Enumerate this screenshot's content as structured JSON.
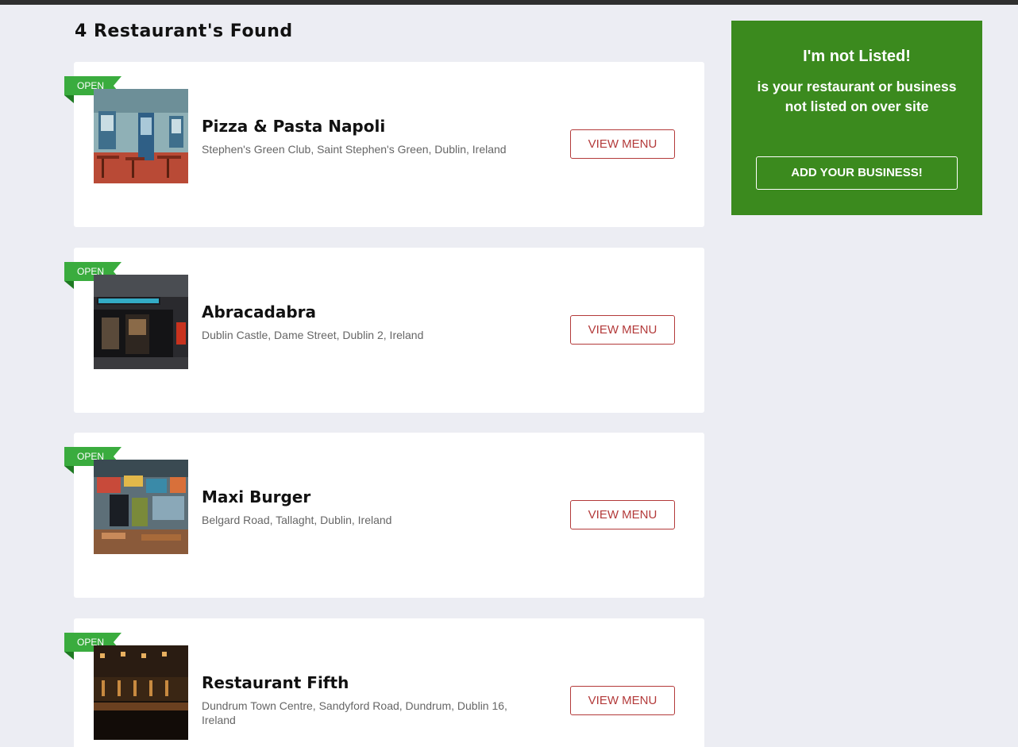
{
  "results": {
    "title": "4 Restaurant's Found"
  },
  "restaurants": [
    {
      "status": "OPEN",
      "name": "Pizza & Pasta Napoli",
      "address": "Stephen's Green Club, Saint Stephen's Green, Dublin, Ireland",
      "button": "VIEW MENU",
      "image": "street-cafe-image"
    },
    {
      "status": "OPEN",
      "name": "Abracadabra",
      "address": "Dublin Castle, Dame Street, Dublin 2, Ireland",
      "button": "VIEW MENU",
      "image": "neon-bar-image"
    },
    {
      "status": "OPEN",
      "name": "Maxi Burger",
      "address": "Belgard Road, Tallaght, Dublin, Ireland",
      "button": "VIEW MENU",
      "image": "colorful-diner-image"
    },
    {
      "status": "OPEN",
      "name": "Restaurant Fifth",
      "address": "Dundrum Town Centre, Sandyford Road, Dundrum, Dublin 16, Ireland",
      "button": "VIEW MENU",
      "image": "dark-bar-interior-image"
    }
  ],
  "promo": {
    "title": "I'm not Listed!",
    "text": "is your restaurant or business not listed on over site",
    "button": "ADD YOUR BUSINESS!"
  },
  "colors": {
    "background": "#ecedf3",
    "open_ribbon": "#3aac3e",
    "menu_button": "#b33a3a",
    "promo_background": "#3b8a1e"
  }
}
